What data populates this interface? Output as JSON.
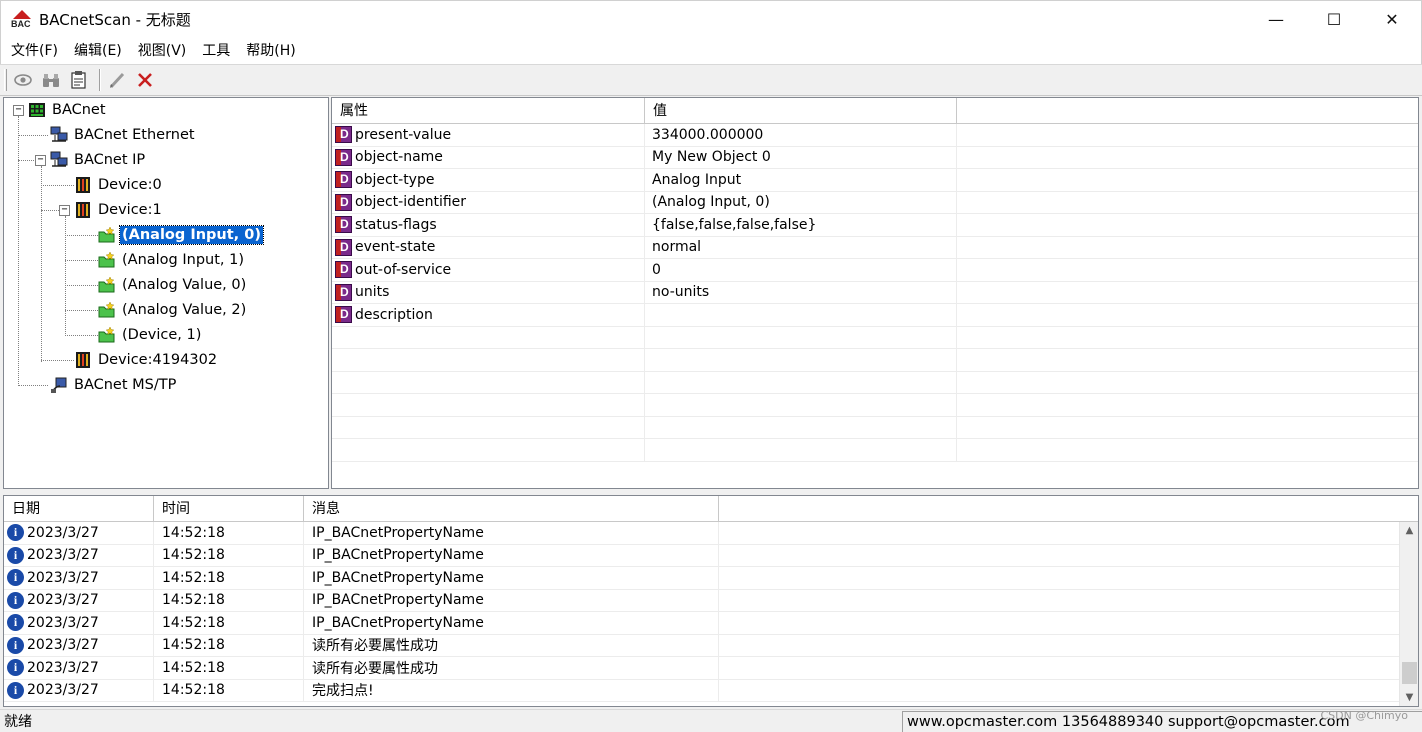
{
  "window": {
    "title": "BACnetScan - 无标题",
    "app_icon_label": "BAC",
    "controls": {
      "minimize": "—",
      "maximize": "☐",
      "close": "✕"
    }
  },
  "menu": [
    "文件(F)",
    "编辑(E)",
    "视图(V)",
    "工具",
    "帮助(H)"
  ],
  "toolbar": {
    "icons": [
      "eye-icon",
      "binoculars-icon",
      "properties-icon",
      "pencil-icon",
      "delete-x-icon"
    ],
    "colors": {
      "delete": "#c81e1e"
    }
  },
  "tree": {
    "root": "BACnet",
    "ethernet": "BACnet Ethernet",
    "ip": "BACnet IP",
    "device0": "Device:0",
    "device1": "Device:1",
    "obj_ai0": "(Analog Input, 0)",
    "obj_ai1": "(Analog Input, 1)",
    "obj_av0": "(Analog Value, 0)",
    "obj_av2": "(Analog Value, 2)",
    "obj_dev1": "(Device, 1)",
    "device4194302": "Device:4194302",
    "mstp": "BACnet MS/TP",
    "selected": "(Analog Input, 0)",
    "expander_open": "−"
  },
  "properties": {
    "headers": [
      "属性",
      "值"
    ],
    "icon_letter": "D",
    "rows": [
      {
        "name": "present-value",
        "value": "334000.000000"
      },
      {
        "name": "object-name",
        "value": "My New Object 0"
      },
      {
        "name": "object-type",
        "value": "Analog Input"
      },
      {
        "name": "object-identifier",
        "value": "(Analog Input, 0)"
      },
      {
        "name": "status-flags",
        "value": "{false,false,false,false}"
      },
      {
        "name": "event-state",
        "value": "normal"
      },
      {
        "name": "out-of-service",
        "value": "0"
      },
      {
        "name": "units",
        "value": "no-units"
      },
      {
        "name": "description",
        "value": ""
      }
    ]
  },
  "log": {
    "headers": [
      "日期",
      "时间",
      "消息"
    ],
    "icon_letter": "i",
    "rows": [
      {
        "date": "2023/3/27",
        "time": "14:52:18",
        "message": "IP_BACnetPropertyName"
      },
      {
        "date": "2023/3/27",
        "time": "14:52:18",
        "message": "IP_BACnetPropertyName"
      },
      {
        "date": "2023/3/27",
        "time": "14:52:18",
        "message": "IP_BACnetPropertyName"
      },
      {
        "date": "2023/3/27",
        "time": "14:52:18",
        "message": "IP_BACnetPropertyName"
      },
      {
        "date": "2023/3/27",
        "time": "14:52:18",
        "message": "IP_BACnetPropertyName"
      },
      {
        "date": "2023/3/27",
        "time": "14:52:18",
        "message": "读所有必要属性成功"
      },
      {
        "date": "2023/3/27",
        "time": "14:52:18",
        "message": "读所有必要属性成功"
      },
      {
        "date": "2023/3/27",
        "time": "14:52:18",
        "message": "完成扫点!"
      }
    ],
    "scroll_up": "▲",
    "scroll_down": "▼"
  },
  "status": {
    "left": "就绪",
    "right": "www.opcmaster.com 13564889340 support@opcmaster.com",
    "watermark": "CSDN @Chimyo"
  }
}
